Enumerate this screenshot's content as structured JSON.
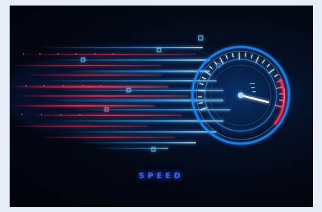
{
  "image": {
    "caption": "SPEED",
    "colors": {
      "background": "#030814",
      "blue_glow": "#2aa8ff",
      "red_glow": "#ff2a4a",
      "caption": "#3a63ff"
    }
  }
}
